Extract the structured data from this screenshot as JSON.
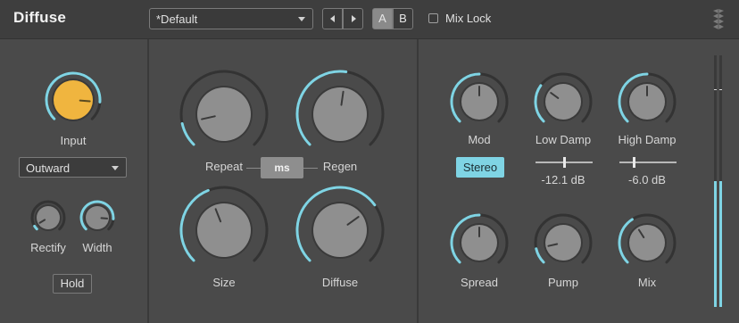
{
  "header": {
    "title": "Diffuse",
    "preset": "*Default",
    "a_label": "A",
    "b_label": "B",
    "mix_lock_label": "Mix Lock",
    "mix_lock_checked": false
  },
  "colors": {
    "accent": "#7fd4e4",
    "input_knob": "#f0b53f",
    "background": "#4a4a4a",
    "header": "#3e3e3e"
  },
  "input_section": {
    "input_label": "Input",
    "input_value_fraction": 0.85,
    "mode_dropdown": "Outward",
    "rectify_label": "Rectify",
    "rectify_value_fraction": 0.05,
    "width_label": "Width",
    "width_value_fraction": 0.85,
    "hold_label": "Hold"
  },
  "delay_section": {
    "repeat_label": "Repeat",
    "repeat_value_fraction": 0.12,
    "ms_label": "ms",
    "regen_label": "Regen",
    "regen_value_fraction": 0.53,
    "size_label": "Size",
    "size_value_fraction": 0.42,
    "diffuse_label": "Diffuse",
    "diffuse_value_fraction": 0.7
  },
  "output_section": {
    "mod_label": "Mod",
    "mod_value_fraction": 0.5,
    "stereo_label": "Stereo",
    "low_damp_label": "Low Damp",
    "low_damp_value_fraction": 0.3,
    "low_damp_readout": "-12.1 dB",
    "low_damp_slider_fraction": 0.5,
    "high_damp_label": "High Damp",
    "high_damp_value_fraction": 0.5,
    "high_damp_readout": "-6.0 dB",
    "high_damp_slider_fraction": 0.25,
    "spread_label": "Spread",
    "spread_value_fraction": 0.5,
    "pump_label": "Pump",
    "pump_value_fraction": 0.12,
    "mix_label": "Mix",
    "mix_value_fraction": 0.38
  },
  "meter": {
    "left_level_fraction": 0.5,
    "right_level_fraction": 0.5,
    "left_peak_fraction": 0.86,
    "right_peak_fraction": 0.86
  }
}
